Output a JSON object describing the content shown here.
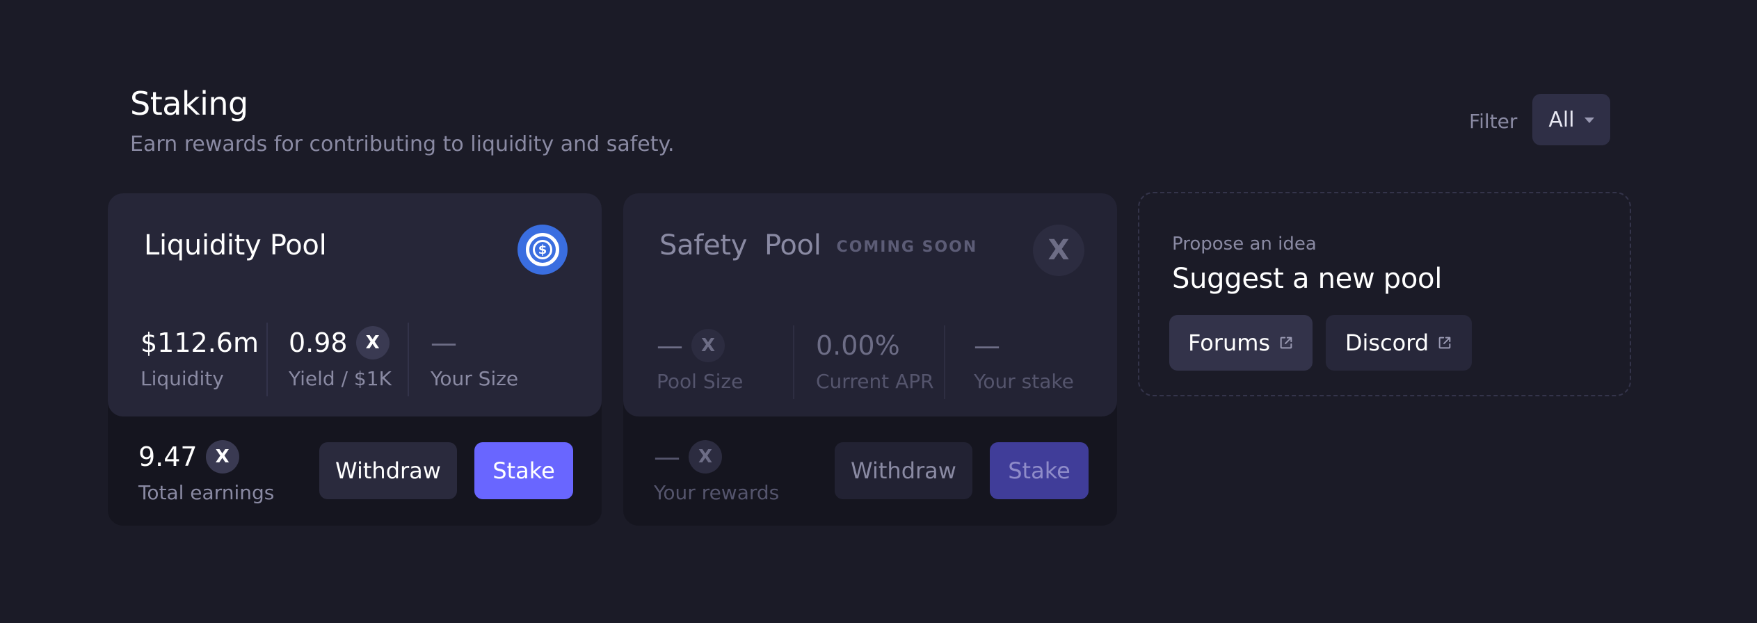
{
  "header": {
    "title": "Staking",
    "subtitle": "Earn rewards for contributing to liquidity and safety."
  },
  "filter": {
    "label": "Filter",
    "value": "All"
  },
  "liquidity_pool": {
    "title": "Liquidity Pool",
    "token_icon": "usdc-icon",
    "stats": {
      "liquidity_value": "$112.6m",
      "liquidity_label": "Liquidity",
      "yield_value": "0.98",
      "yield_label": "Yield / $1K",
      "size_value": "—",
      "size_label": "Your Size"
    },
    "earnings_value": "9.47",
    "earnings_label": "Total earnings",
    "withdraw_label": "Withdraw",
    "stake_label": "Stake"
  },
  "safety_pool": {
    "title": "Safety  Pool",
    "badge": "COMING SOON",
    "token_icon": "x-token-icon",
    "stats": {
      "pool_size_value": "—",
      "pool_size_label": "Pool Size",
      "apr_value": "0.00%",
      "apr_label": "Current APR",
      "stake_value": "—",
      "stake_label": "Your stake"
    },
    "rewards_value": "—",
    "rewards_label": "Your rewards",
    "withdraw_label": "Withdraw",
    "stake_label": "Stake"
  },
  "suggest": {
    "kicker": "Propose an idea",
    "title": "Suggest a new pool",
    "forums_label": "Forums",
    "discord_label": "Discord"
  },
  "colors": {
    "background": "#1b1b27",
    "card": "#262638",
    "accent": "#6966ff",
    "usdc": "#3a6ee0"
  }
}
